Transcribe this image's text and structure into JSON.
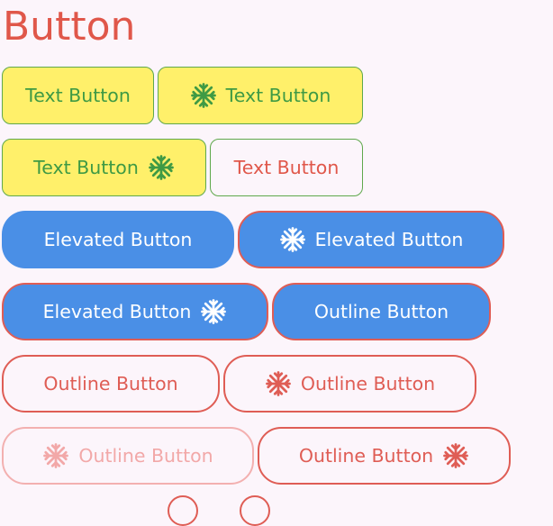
{
  "title": "Button",
  "buttons": {
    "text1": "Text Button",
    "text2": "Text Button",
    "text3": "Text Button",
    "text4": "Text Button",
    "elev1": "Elevated Button",
    "elev2": "Elevated Button",
    "elev3": "Elevated Button",
    "outlElev": "Outline Button",
    "outl1": "Outline Button",
    "outl2": "Outline Button",
    "outlDisabled": "Outline Button",
    "outl3": "Outline Button"
  },
  "icons": {
    "snowflake": "snowflake-icon"
  },
  "colors": {
    "background": "#fcf5fb",
    "accent_red": "#df5d55",
    "text_green": "#3f9a44",
    "button_yellow": "#fff06a",
    "button_blue": "#4a8fe6"
  }
}
